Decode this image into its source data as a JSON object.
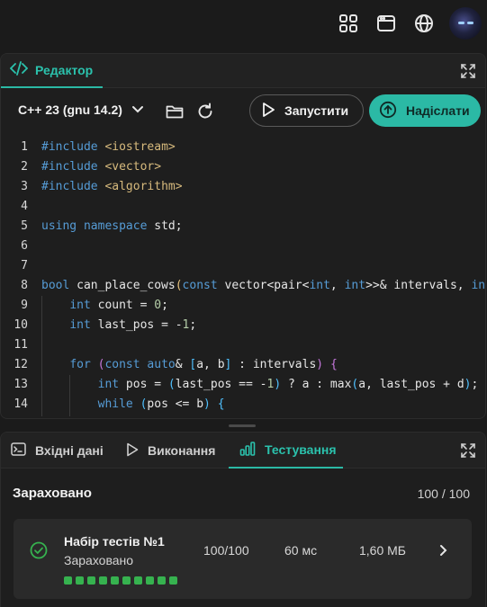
{
  "editor": {
    "tab_label": "Редактор",
    "language": "C++ 23 (gnu 14.2)",
    "run_label": "Запустити",
    "submit_label": "Надіслати"
  },
  "code": {
    "lines": [
      {
        "n": "1",
        "html": "<span class='kw'>#include</span> <span class='inc'>&lt;iostream&gt;</span>"
      },
      {
        "n": "2",
        "html": "<span class='kw'>#include</span> <span class='inc'>&lt;vector&gt;</span>"
      },
      {
        "n": "3",
        "html": "<span class='kw'>#include</span> <span class='inc'>&lt;algorithm&gt;</span>"
      },
      {
        "n": "4",
        "html": ""
      },
      {
        "n": "5",
        "html": "<span class='kw'>using</span> <span class='kw'>namespace</span> std;"
      },
      {
        "n": "6",
        "html": ""
      },
      {
        "n": "7",
        "html": ""
      },
      {
        "n": "8",
        "html": "<span class='kw'>bool</span> can_place_cows<span class='br1'>(</span><span class='kw'>const</span> vector&lt;pair&lt;<span class='kw'>int</span>, <span class='kw'>int</span>&gt;&gt;&amp; intervals, <span class='kw'>int</span>"
      },
      {
        "n": "9",
        "html": "    <span class='kw'>int</span> count = <span class='num'>0</span>;"
      },
      {
        "n": "10",
        "html": "    <span class='kw'>int</span> last_pos = -<span class='num'>1</span>;"
      },
      {
        "n": "11",
        "html": ""
      },
      {
        "n": "12",
        "html": "    <span class='kw'>for</span> <span class='br2'>(</span><span class='kw'>const</span> <span class='kw'>auto</span>&amp; <span class='br3'>[</span>a, b<span class='br3'>]</span> : intervals<span class='br2'>)</span> <span class='br2'>{</span>"
      },
      {
        "n": "13",
        "html": "        <span class='kw'>int</span> pos = <span class='br3'>(</span>last_pos == -<span class='num'>1</span><span class='br3'>)</span> ? a : max<span class='br3'>(</span>a, last_pos + d<span class='br3'>)</span>;"
      },
      {
        "n": "14",
        "html": "        <span class='kw'>while</span> <span class='br3'>(</span>pos &lt;= b<span class='br3'>)</span> <span class='br3'>{</span>"
      }
    ]
  },
  "bottom": {
    "tabs": [
      "Вхідні дані",
      "Виконання",
      "Тестування"
    ],
    "active_tab": 2,
    "result_title": "Зараховано",
    "result_score": "100 / 100",
    "testset": {
      "name": "Набір тестів №1",
      "status": "Зараховано",
      "score": "100/100",
      "time": "60 мс",
      "memory": "1,60 МБ",
      "passed_tests": 10
    }
  },
  "colors": {
    "accent": "#2bb9a5",
    "success": "#36b24f",
    "background": "#1b1b1b"
  },
  "icons": [
    "grid-icon",
    "browser-window-icon",
    "globe-icon",
    "code-icon",
    "expand-icon",
    "folder-icon",
    "refresh-icon",
    "play-icon",
    "upload-icon",
    "terminal-icon",
    "bar-chart-icon",
    "check-circle-icon",
    "chevron-right-icon",
    "chevron-down-icon"
  ]
}
